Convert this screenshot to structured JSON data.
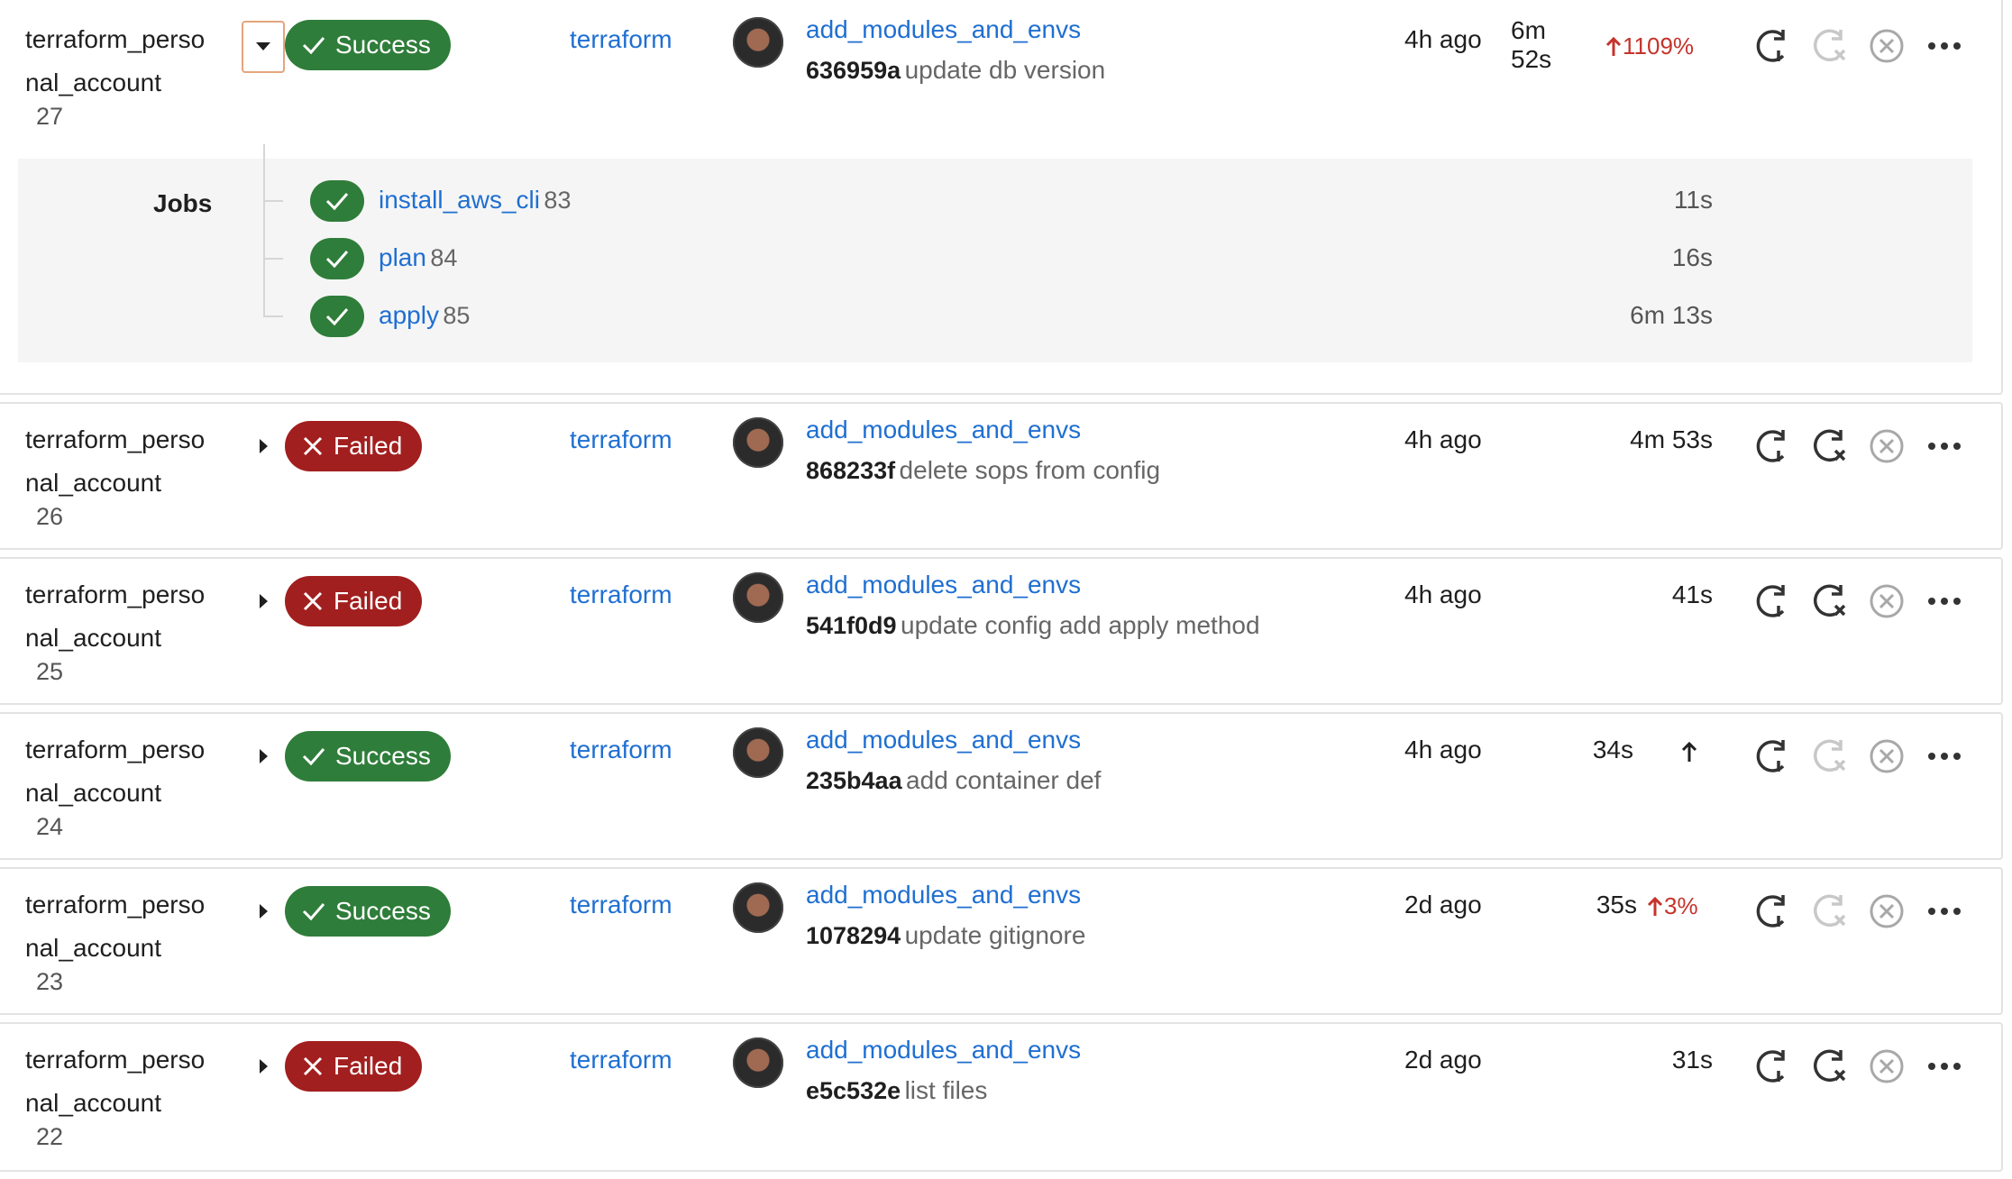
{
  "colors": {
    "success": "#2f7d3a",
    "failed": "#a21f1f",
    "link": "#1f6fd1",
    "trend_up": "#c5332b"
  },
  "icons": {
    "retry": "retry-icon",
    "retry_disabled": "retry-failed-icon",
    "cancel": "cancel-icon",
    "more": "more-actions-icon",
    "expand": "chevron-down-icon",
    "collapse": "caret-right-icon"
  },
  "expanded_jobs": {
    "label": "Jobs",
    "items": [
      {
        "name": "install_aws_cli",
        "id": "83",
        "duration": "11s"
      },
      {
        "name": "plan",
        "id": "84",
        "duration": "16s"
      },
      {
        "name": "apply",
        "id": "85",
        "duration": "6m 13s"
      }
    ]
  },
  "pipelines": [
    {
      "name_line1": "terraform_perso",
      "name_line2": "nal_account",
      "number": "27",
      "status": "Success",
      "stage": "terraform",
      "branch": "add_modules_and_envs",
      "sha": "636959a",
      "message": "update db version",
      "time": "4h ago",
      "duration_line1": "6m",
      "duration_line2": "52s",
      "duration": "",
      "trend": "1109%"
    },
    {
      "name_line1": "terraform_perso",
      "name_line2": "nal_account",
      "number": "26",
      "status": "Failed",
      "stage": "terraform",
      "branch": "add_modules_and_envs",
      "sha": "868233f",
      "message": "delete sops from config",
      "time": "4h ago",
      "duration": "4m 53s",
      "trend": ""
    },
    {
      "name_line1": "terraform_perso",
      "name_line2": "nal_account",
      "number": "25",
      "status": "Failed",
      "stage": "terraform",
      "branch": "add_modules_and_envs",
      "sha": "541f0d9",
      "message": "update config add apply method",
      "time": "4h ago",
      "duration": "41s",
      "trend": ""
    },
    {
      "name_line1": "terraform_perso",
      "name_line2": "nal_account",
      "number": "24",
      "status": "Success",
      "stage": "terraform",
      "branch": "add_modules_and_envs",
      "sha": "235b4aa",
      "message": "add container def",
      "time": "4h ago",
      "duration": "34s",
      "trend": ""
    },
    {
      "name_line1": "terraform_perso",
      "name_line2": "nal_account",
      "number": "23",
      "status": "Success",
      "stage": "terraform",
      "branch": "add_modules_and_envs",
      "sha": "1078294",
      "message": "update gitignore",
      "time": "2d ago",
      "duration": "35s",
      "trend": "3%"
    },
    {
      "name_line1": "terraform_perso",
      "name_line2": "nal_account",
      "number": "22",
      "status": "Failed",
      "stage": "terraform",
      "branch": "add_modules_and_envs",
      "sha": "e5c532e",
      "message": "list files",
      "time": "2d ago",
      "duration": "31s",
      "trend": ""
    }
  ]
}
